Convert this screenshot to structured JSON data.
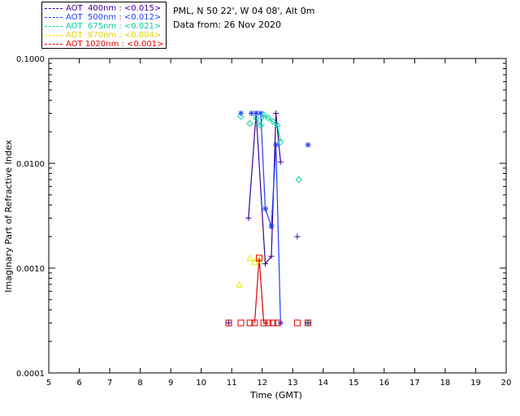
{
  "header": {
    "site_line": "PML, N 50 22', W 04 08', Alt 0m",
    "date_line": "Data from: 26 Nov 2020"
  },
  "legend": [
    {
      "label": "AOT  400nm : <0.015>",
      "color": "#3c0096"
    },
    {
      "label": "AOT  500nm : <0.012>",
      "color": "#1e3cff"
    },
    {
      "label": "AOT  675nm : <0.021>",
      "color": "#00d2a0"
    },
    {
      "label": "AOT  870nm : <0.004>",
      "color": "#f0e600"
    },
    {
      "label": "AOT 1020nm : <0.001>",
      "color": "#e10000"
    }
  ],
  "chart_data": {
    "type": "line",
    "title": "",
    "xlabel": "Time (GMT)",
    "ylabel": "Imaginary Part of Refractive Index",
    "xlim": [
      5,
      20
    ],
    "ylim": [
      0.0001,
      0.1
    ],
    "yscale": "log",
    "x_ticks": [
      "5",
      "6",
      "7",
      "8",
      "9",
      "10",
      "11",
      "12",
      "13",
      "14",
      "15",
      "16",
      "17",
      "18",
      "19",
      "20"
    ],
    "y_ticks": [
      "0.0001",
      "0.0010",
      "0.0100",
      "0.1000"
    ],
    "series": [
      {
        "name": "AOT  400nm : <0.015>",
        "color": "#3c0096",
        "marker": "plus",
        "points": [
          [
            10.9,
            0.0003
          ],
          [
            11.55,
            0.003
          ],
          [
            11.8,
            0.03
          ],
          [
            12.1,
            0.0011
          ],
          [
            12.3,
            0.0013
          ],
          [
            12.45,
            0.03
          ],
          [
            12.6,
            0.0103
          ],
          [
            13.15,
            0.002
          ],
          [
            13.5,
            0.0003
          ]
        ],
        "line": [
          [
            11.55,
            0.003
          ],
          [
            11.8,
            0.03
          ],
          [
            12.1,
            0.0011
          ],
          [
            12.3,
            0.0013
          ],
          [
            12.45,
            0.03
          ],
          [
            12.6,
            0.0103
          ]
        ]
      },
      {
        "name": "AOT  500nm : <0.012>",
        "color": "#1e3cff",
        "marker": "asterisk",
        "points": [
          [
            11.3,
            0.03
          ],
          [
            11.65,
            0.03
          ],
          [
            11.8,
            0.03
          ],
          [
            11.95,
            0.03
          ],
          [
            12.1,
            0.0037
          ],
          [
            12.3,
            0.0025
          ],
          [
            12.45,
            0.015
          ],
          [
            12.6,
            0.0003
          ],
          [
            13.5,
            0.015
          ]
        ],
        "line": [
          [
            11.8,
            0.03
          ],
          [
            11.95,
            0.03
          ],
          [
            12.1,
            0.0037
          ],
          [
            12.3,
            0.0025
          ],
          [
            12.45,
            0.015
          ],
          [
            12.6,
            0.0003
          ]
        ]
      },
      {
        "name": "AOT  675nm : <0.021>",
        "color": "#00d2a0",
        "marker": "diamond",
        "points": [
          [
            11.3,
            0.028
          ],
          [
            11.6,
            0.024
          ],
          [
            11.8,
            0.027
          ],
          [
            11.95,
            0.023
          ],
          [
            12.05,
            0.029
          ],
          [
            12.2,
            0.027
          ],
          [
            12.35,
            0.025
          ],
          [
            12.5,
            0.023
          ],
          [
            12.6,
            0.016
          ],
          [
            13.2,
            0.007
          ],
          [
            13.5,
            0.0003
          ]
        ],
        "line": [
          [
            11.8,
            0.027
          ],
          [
            11.95,
            0.023
          ],
          [
            12.05,
            0.029
          ],
          [
            12.2,
            0.027
          ],
          [
            12.35,
            0.025
          ],
          [
            12.5,
            0.023
          ],
          [
            12.6,
            0.016
          ]
        ]
      },
      {
        "name": "AOT  870nm : <0.004>",
        "color": "#f0e600",
        "marker": "triangle",
        "points": [
          [
            11.25,
            0.0007
          ],
          [
            11.6,
            0.00125
          ],
          [
            11.75,
            0.00115
          ],
          [
            11.9,
            0.0012
          ]
        ],
        "line": []
      },
      {
        "name": "AOT 1020nm : <0.001>",
        "color": "#e10000",
        "marker": "square",
        "points": [
          [
            10.9,
            0.0003
          ],
          [
            11.3,
            0.0003
          ],
          [
            11.6,
            0.0003
          ],
          [
            11.75,
            0.0003
          ],
          [
            11.9,
            0.00125
          ],
          [
            12.05,
            0.0003
          ],
          [
            12.2,
            0.0003
          ],
          [
            12.35,
            0.0003
          ],
          [
            12.5,
            0.0003
          ],
          [
            13.15,
            0.0003
          ],
          [
            13.5,
            0.0003
          ]
        ],
        "line": [
          [
            11.75,
            0.0003
          ],
          [
            11.9,
            0.00125
          ],
          [
            12.05,
            0.0003
          ],
          [
            12.2,
            0.0003
          ]
        ]
      }
    ]
  }
}
